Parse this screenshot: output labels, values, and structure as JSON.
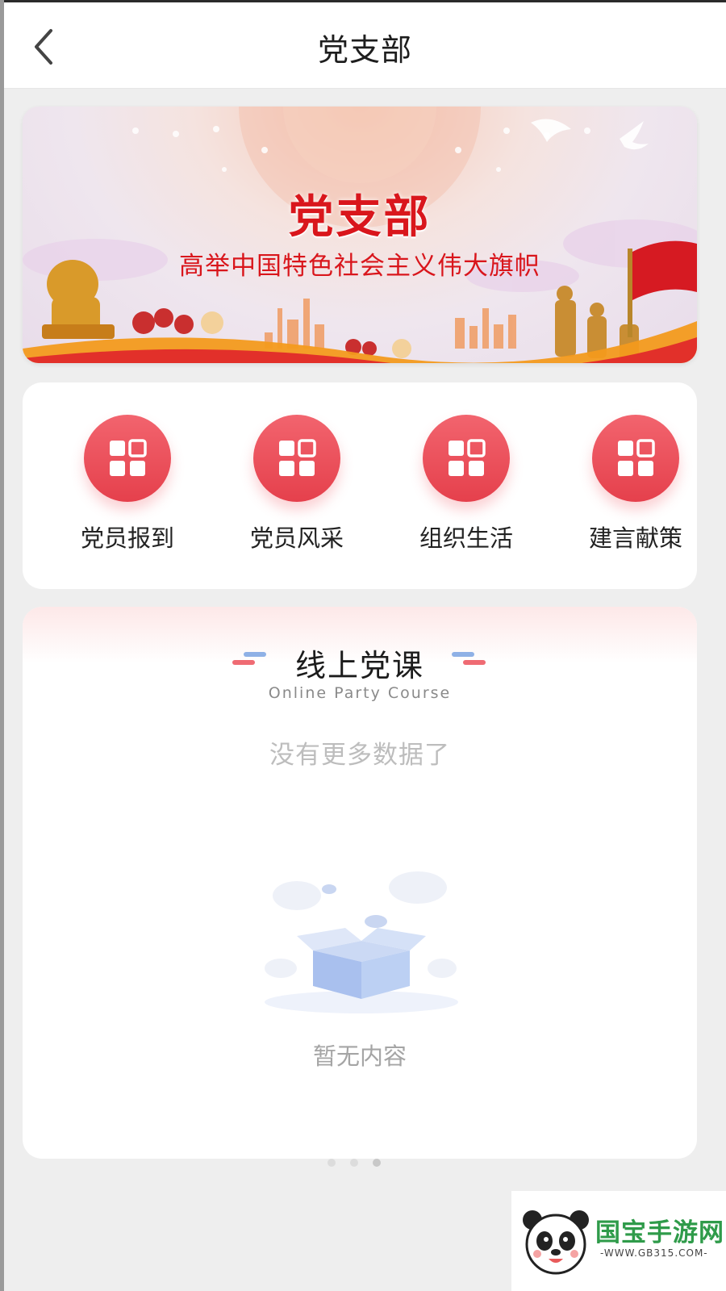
{
  "header": {
    "title": "党支部"
  },
  "banner": {
    "title": "党支部",
    "slogan": "高举中国特色社会主义伟大旗帜"
  },
  "quick_menu": [
    {
      "label": "党员报到",
      "icon": "grid-icon"
    },
    {
      "label": "党员风采",
      "icon": "grid-icon"
    },
    {
      "label": "组织生活",
      "icon": "grid-icon"
    },
    {
      "label": "建言献策",
      "icon": "grid-icon"
    }
  ],
  "course_section": {
    "title": "线上党课",
    "subtitle": "Online Party Course",
    "no_more_text": "没有更多数据了",
    "empty_text": "暂无内容"
  },
  "watermark": {
    "brand": "国宝手游网",
    "url": "-WWW.GB315.COM-"
  },
  "colors": {
    "accent_red": "#e5404c",
    "banner_text_red": "#d9161c"
  }
}
